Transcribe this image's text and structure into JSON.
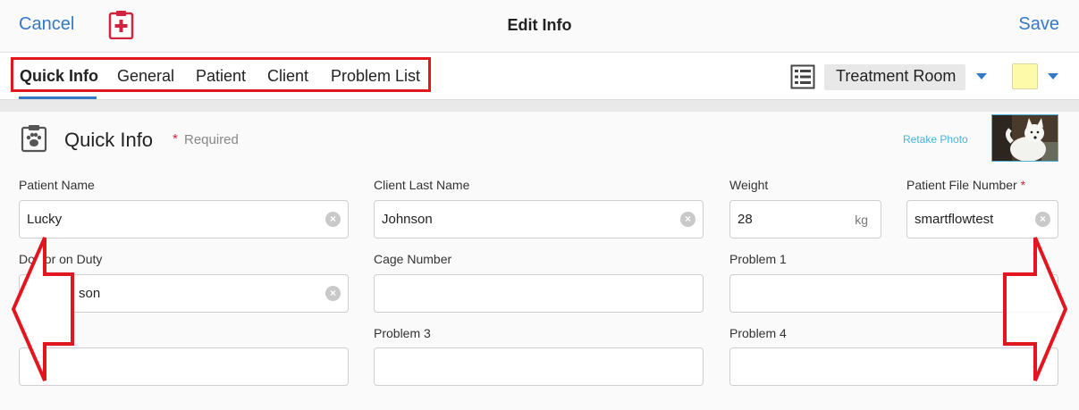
{
  "header": {
    "cancel_label": "Cancel",
    "title": "Edit Info",
    "save_label": "Save",
    "app_icon": "clipboard-medical-icon"
  },
  "tabs": [
    {
      "label": "Quick Info",
      "active": true
    },
    {
      "label": "General",
      "active": false
    },
    {
      "label": "Patient",
      "active": false
    },
    {
      "label": "Client",
      "active": false
    },
    {
      "label": "Problem List",
      "active": false
    }
  ],
  "toolbar": {
    "location_selected": "Treatment Room",
    "color_selected": "#fdfbaa",
    "list_icon": "list-view-icon"
  },
  "section": {
    "title": "Quick Info",
    "required_marker": "*",
    "required_text": "Required",
    "retake_photo_label": "Retake Photo",
    "section_icon": "paw-clipboard-icon"
  },
  "fields": {
    "patient_name": {
      "label": "Patient Name",
      "value": "Lucky"
    },
    "client_last_name": {
      "label": "Client Last Name",
      "value": "Johnson"
    },
    "weight": {
      "label": "Weight",
      "value": "28",
      "unit": "kg"
    },
    "patient_file_number": {
      "label": "Patient File Number",
      "value": "smartflowtest",
      "required": true
    },
    "doctor_on_duty": {
      "label": "Doctor on Duty",
      "value": "son"
    },
    "cage_number": {
      "label": "Cage Number",
      "value": ""
    },
    "problem_1": {
      "label": "Problem 1",
      "value": ""
    },
    "problem_2": {
      "label": "2",
      "value": ""
    },
    "problem_3": {
      "label": "Problem 3",
      "value": ""
    },
    "problem_4": {
      "label": "Problem 4",
      "value": ""
    }
  },
  "colors": {
    "accent": "#3478c8",
    "annotation_red": "#e1161f",
    "required_red": "#d0253f",
    "link_teal": "#4bb1d6"
  }
}
